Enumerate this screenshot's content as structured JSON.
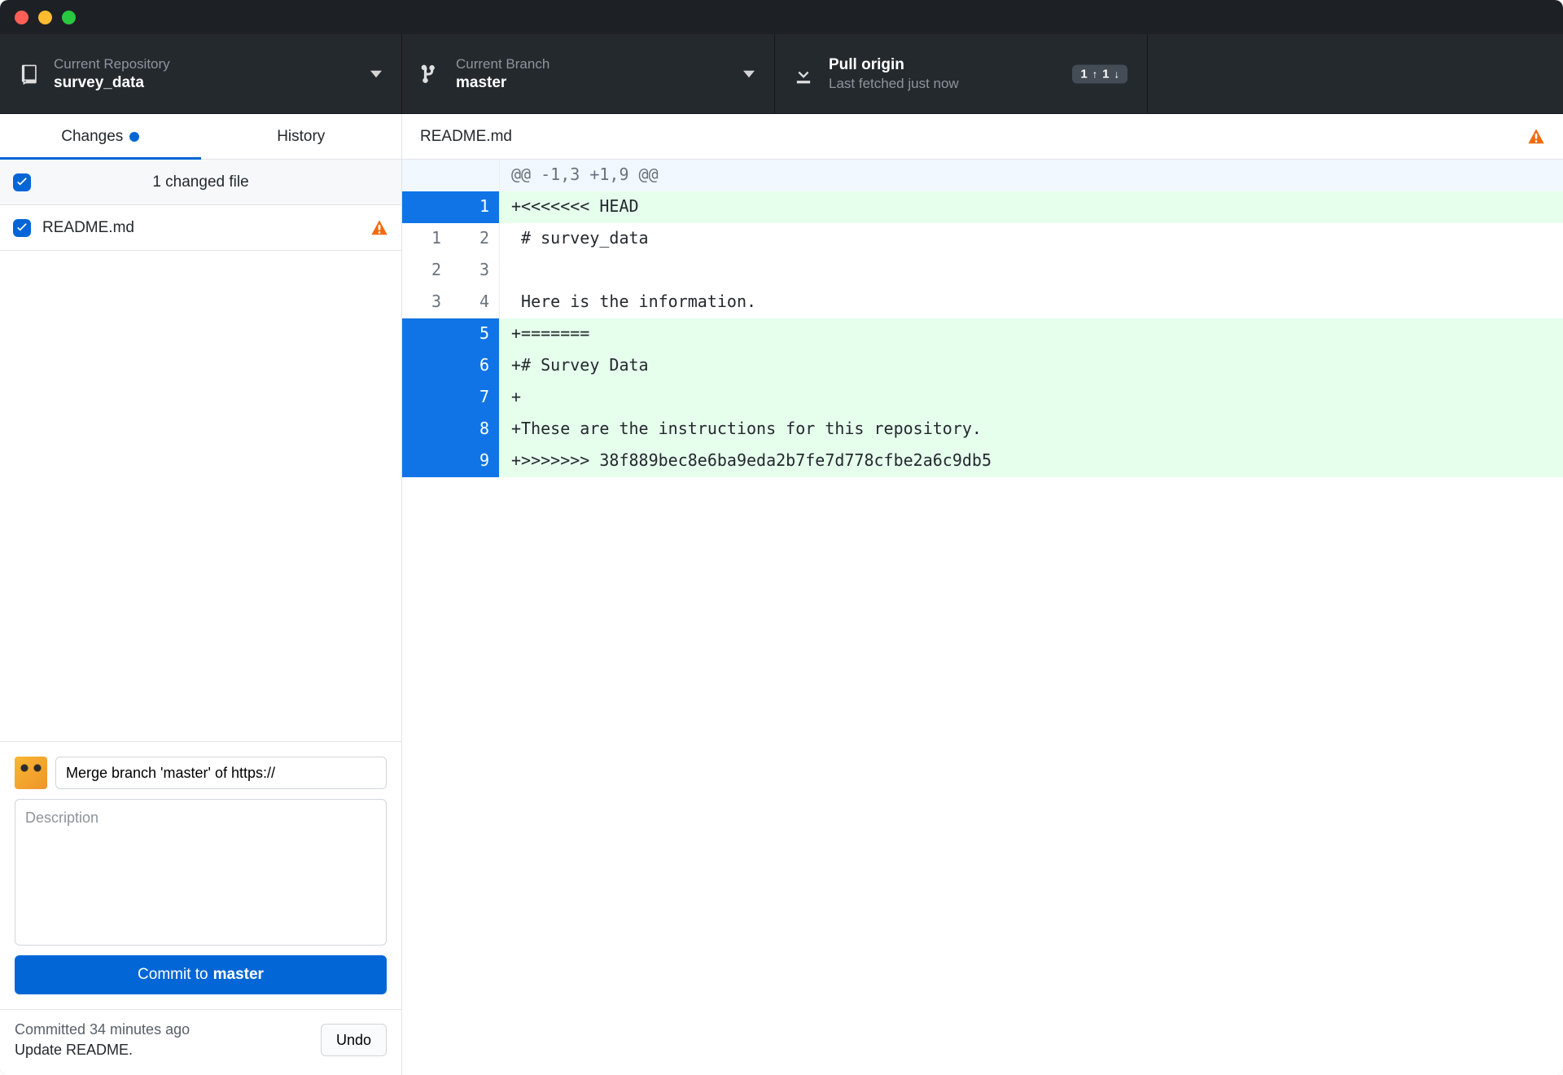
{
  "titlebar": {},
  "toolbar": {
    "repo": {
      "label": "Current Repository",
      "value": "survey_data"
    },
    "branch": {
      "label": "Current Branch",
      "value": "master"
    },
    "pull": {
      "label": "Pull origin",
      "sub": "Last fetched just now",
      "badge_up": "1",
      "badge_down": "1"
    }
  },
  "sidebar": {
    "tabs": {
      "changes": "Changes",
      "history": "History"
    },
    "changes_count": "1 changed file",
    "file": "README.md"
  },
  "commit": {
    "summary_value": "Merge branch 'master' of https://",
    "desc_placeholder": "Description",
    "btn_prefix": "Commit to ",
    "btn_branch": "master",
    "footer_time": "Committed 34 minutes ago",
    "footer_msg": "Update README.",
    "undo": "Undo"
  },
  "diff": {
    "title": "README.md",
    "lines": [
      {
        "type": "hunk",
        "old": "",
        "new": "",
        "text": "@@ -1,3 +1,9 @@"
      },
      {
        "type": "add",
        "sel": true,
        "old": "",
        "new": "1",
        "text": "+<<<<<<< HEAD"
      },
      {
        "type": "ctx",
        "old": "1",
        "new": "2",
        "text": " # survey_data"
      },
      {
        "type": "ctx",
        "old": "2",
        "new": "3",
        "text": " "
      },
      {
        "type": "ctx",
        "old": "3",
        "new": "4",
        "text": " Here is the information."
      },
      {
        "type": "add",
        "sel": true,
        "old": "",
        "new": "5",
        "text": "+======="
      },
      {
        "type": "add",
        "sel": true,
        "old": "",
        "new": "6",
        "text": "+# Survey Data"
      },
      {
        "type": "add",
        "sel": true,
        "old": "",
        "new": "7",
        "text": "+"
      },
      {
        "type": "add",
        "sel": true,
        "old": "",
        "new": "8",
        "text": "+These are the instructions for this repository."
      },
      {
        "type": "add",
        "sel": true,
        "old": "",
        "new": "9",
        "text": "+>>>>>>> 38f889bec8e6ba9eda2b7fe7d778cfbe2a6c9db5"
      }
    ]
  }
}
